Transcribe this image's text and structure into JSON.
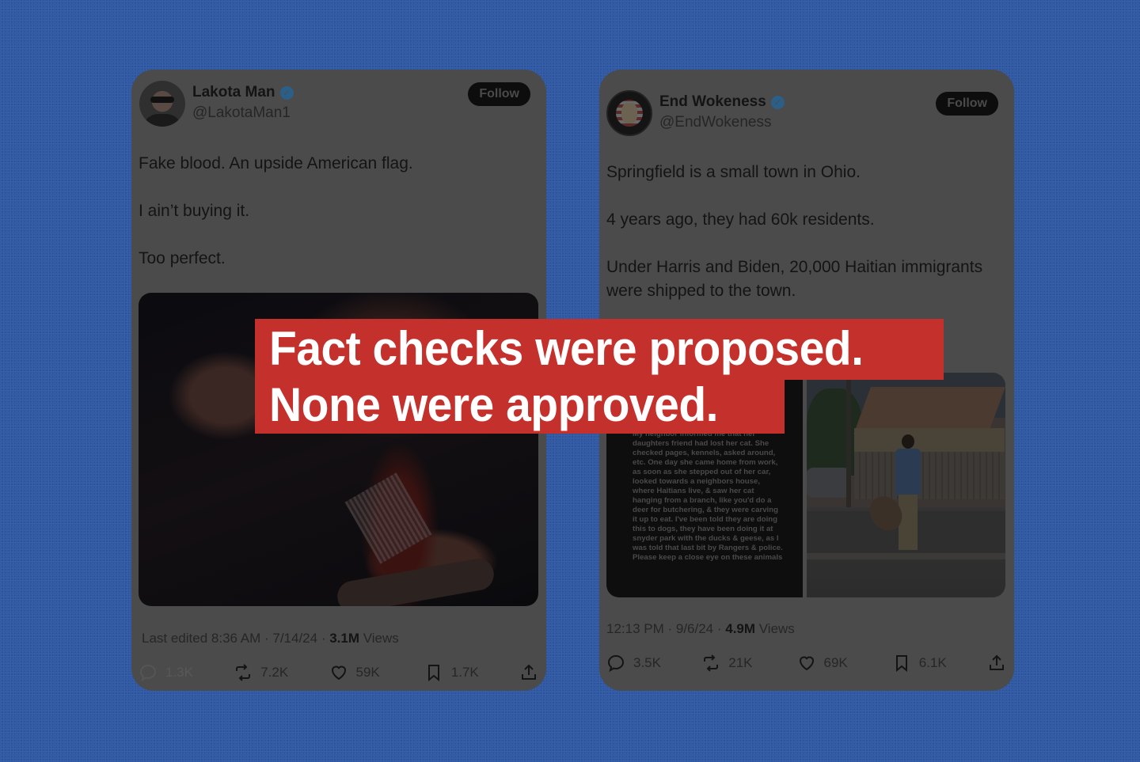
{
  "colors": {
    "background": "#2f59a3",
    "card": "#4b4b4b",
    "banner": "#c4302b",
    "verified": "#2b5f87"
  },
  "banner": {
    "line1": "Fact checks were proposed.",
    "line2": "None were approved."
  },
  "tweets": [
    {
      "name": "Lakota Man",
      "handle": "@LakotaMan1",
      "verified_icon": "verified-badge-icon",
      "follow_label": "Follow",
      "body": [
        "Fake blood. An upside American flag.",
        "I ain’t buying it.",
        "Too perfect."
      ],
      "meta": {
        "prefix": "Last edited 8:36 AM · 7/14/24  · ",
        "views": "3.1M",
        "views_label": " Views"
      },
      "actions": {
        "replies": "1.3K",
        "reposts": "7.2K",
        "likes": "59K",
        "bookmarks": "1.7K"
      }
    },
    {
      "name": "End Wokeness",
      "handle": "@EndWokeness",
      "verified_icon": "verified-badge-icon",
      "follow_label": "Follow",
      "body": [
        "Springfield is a small town in Ohio.",
        "4 years ago, they had 60k residents.",
        "Under Harris and Biden, 20,000 Haitian immigrants were shipped to the town."
      ],
      "note_image_text": "My neighbor informed me that her daughters friend had lost her cat. She checked pages, kennels, asked around, etc. One day she came home from work, as soon as she stepped out of her car, looked towards a neighbors house, where Haitians live, & saw her cat hanging from a branch, like you'd do a deer for butchering, & they were carving it up to eat. I've been told they are doing this to dogs, they have been doing it at snyder park with the ducks & geese, as I was told that last bit by Rangers & police. Please keep a close eye on these animals",
      "meta": {
        "prefix": "12:13 PM · 9/6/24 · ",
        "views": "4.9M",
        "views_label": " Views"
      },
      "actions": {
        "replies": "3.5K",
        "reposts": "21K",
        "likes": "69K",
        "bookmarks": "6.1K"
      }
    }
  ]
}
